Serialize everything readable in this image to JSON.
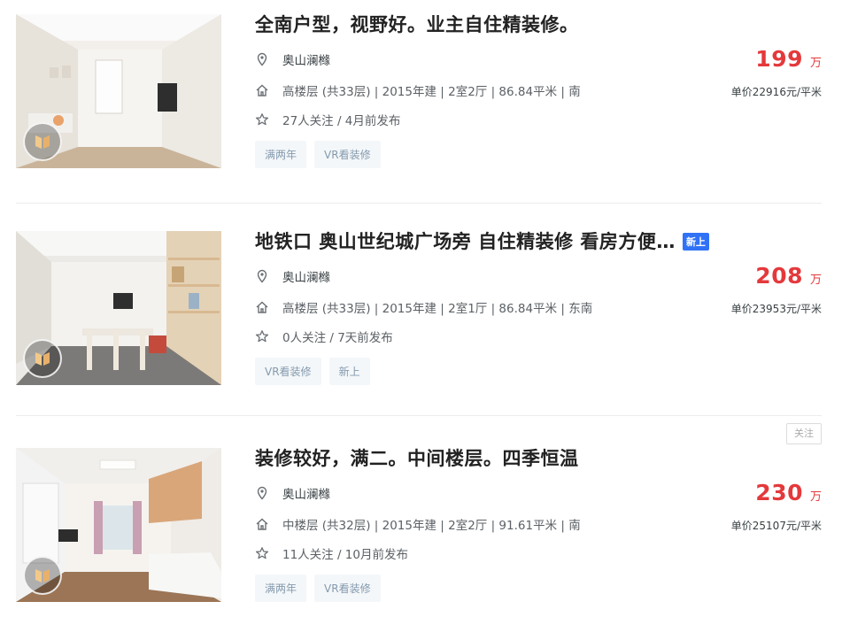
{
  "listings": [
    {
      "title": "全南户型，视野好。业主自住精装修。",
      "community": "奥山澜橼",
      "house_info": "高楼层 (共33层) | 2015年建 | 2室2厅 | 86.84平米 | 南",
      "follow_info": "27人关注 / 4月前发布",
      "tags": [
        "满两年",
        "VR看装修"
      ],
      "price": "199",
      "price_unit": "万",
      "unit_price": "单价22916元/平米"
    },
    {
      "title": "地铁口 奥山世纪城广场旁 自住精装修 看房方便…",
      "badge": "新上",
      "community": "奥山澜橼",
      "house_info": "高楼层 (共33层) | 2015年建 | 2室1厅 | 86.84平米 | 东南",
      "follow_info": "0人关注 / 7天前发布",
      "tags": [
        "VR看装修",
        "新上"
      ],
      "price": "208",
      "price_unit": "万",
      "unit_price": "单价23953元/平米"
    },
    {
      "title": "装修较好，满二。中间楼层。四季恒温",
      "community": "奥山澜橼",
      "house_info": "中楼层 (共32层) | 2015年建 | 2室2厅 | 91.61平米 | 南",
      "follow_info": "11人关注 / 10月前发布",
      "tags": [
        "满两年",
        "VR看装修"
      ],
      "price": "230",
      "price_unit": "万",
      "unit_price": "单价25107元/平米",
      "follow_button": "关注"
    }
  ],
  "icons": {
    "location": "location-pin-icon",
    "house": "house-icon",
    "star": "star-icon",
    "vr": "vr-icon"
  },
  "colors": {
    "price": "#e4393c",
    "badge": "#3072f6",
    "tag_text": "#849aae",
    "tag_bg": "#f4f7f9"
  }
}
